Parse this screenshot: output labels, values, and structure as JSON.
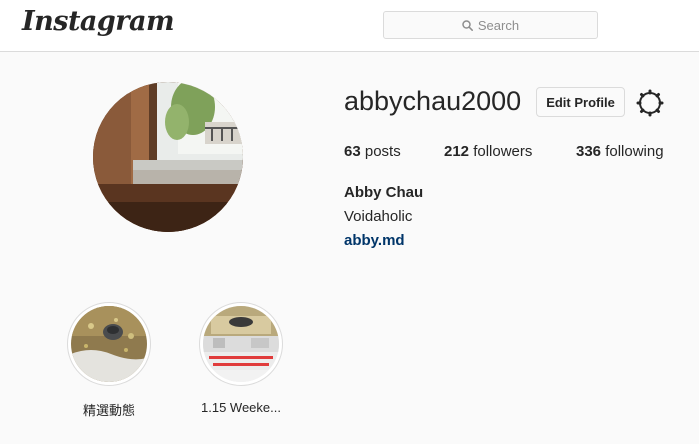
{
  "header": {
    "logo": "Instagram",
    "search": {
      "placeholder": "Search",
      "icon": "search-icon"
    }
  },
  "profile": {
    "username": "abbychau2000",
    "edit_label": "Edit Profile",
    "settings_icon": "gear-icon",
    "stats": {
      "posts": {
        "count": "63",
        "label": "posts"
      },
      "followers": {
        "count": "212",
        "label": "followers"
      },
      "following": {
        "count": "336",
        "label": "following"
      }
    },
    "full_name": "Abby Chau",
    "bio": "Voidaholic",
    "website": "abby.md"
  },
  "highlights": [
    {
      "label": "精選動態"
    },
    {
      "label": "1.15 Weeke..."
    }
  ],
  "colors": {
    "link": "#003569",
    "border": "#dbdbdb",
    "background": "#fafafa"
  }
}
